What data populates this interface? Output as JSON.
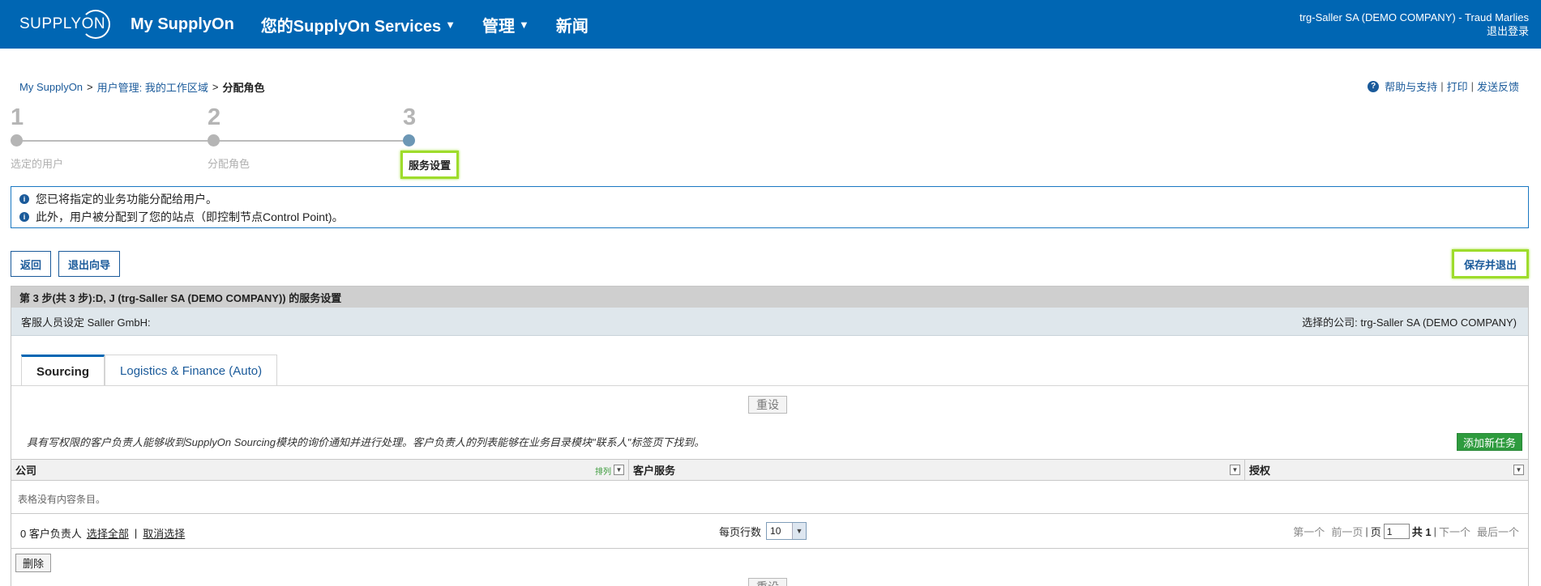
{
  "header": {
    "logo_text": "SUPPLYON",
    "nav": [
      {
        "label": "My SupplyOn",
        "has_caret": false
      },
      {
        "label": "您的SupplyOn Services",
        "has_caret": true
      },
      {
        "label": "管理",
        "has_caret": true
      },
      {
        "label": "新闻",
        "has_caret": false
      }
    ],
    "user": "trg-Saller SA (DEMO COMPANY) - Traud Marlies",
    "logout": "退出登录",
    "colors": {
      "brand": "#0066b3"
    }
  },
  "breadcrumb": {
    "items": [
      "My SupplyOn",
      "用户管理: 我的工作区域"
    ],
    "current": "分配角色",
    "separator": ">"
  },
  "help_links": [
    "帮助与支持",
    "打印",
    "发送反馈"
  ],
  "steps": [
    {
      "num": "1",
      "label": "选定的用户",
      "active": false
    },
    {
      "num": "2",
      "label": "分配角色",
      "active": false
    },
    {
      "num": "3",
      "label": "服务设置",
      "active": true
    }
  ],
  "info": [
    "您已将指定的业务功能分配给用户。",
    "此外，用户被分配到了您的站点（即控制节点Control Point)。"
  ],
  "buttons": {
    "back": "返回",
    "exit_wizard": "退出向导",
    "save_exit": "保存并退出"
  },
  "panel": {
    "title": "第 3 步(共 3 步):D, J (trg-Saller SA (DEMO COMPANY)) 的服务设置",
    "sub_left": "客服人员设定 Saller GmbH:",
    "sub_right": "选择的公司: trg-Saller SA (DEMO COMPANY)",
    "tabs": [
      "Sourcing",
      "Logistics & Finance (Auto)"
    ],
    "active_tab": "Sourcing",
    "reset": "重设",
    "description": "具有写权限的客户负责人能够收到SupplyOn Sourcing模块的询价通知并进行处理。客户负责人的列表能够在业务目录模块\"联系人\"标签页下找到。",
    "add_task": "添加新任务",
    "columns": [
      "公司",
      "客户服务",
      "授权"
    ],
    "sort_label": "排列",
    "empty_text": "表格没有内容条目。",
    "pager": {
      "count_text": "0 客户负责人",
      "select_all": "选择全部",
      "deselect": "取消选择",
      "rows_per_page_label": "每页行数",
      "rows_per_page": "10",
      "first": "第一个",
      "prev": "前一页",
      "page_label": "页",
      "page": "1",
      "of_label": "共 1",
      "next": "下一个",
      "last": "最后一个"
    },
    "delete": "删除"
  }
}
